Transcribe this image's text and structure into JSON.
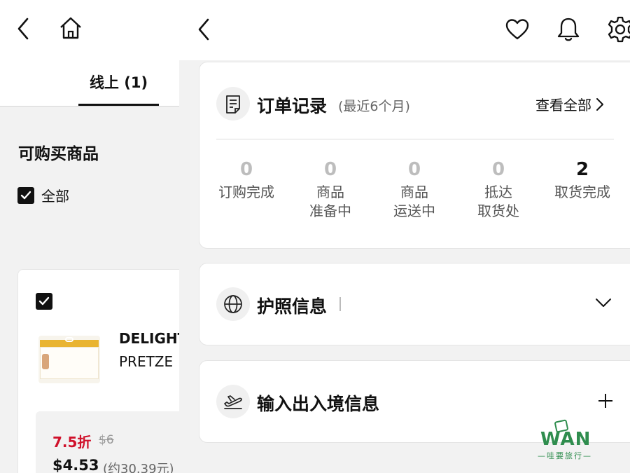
{
  "left_page": {
    "tabs": [
      {
        "label": "线上 (1)"
      }
    ],
    "section_title": "可购买商品",
    "select_all_label": "全部",
    "product": {
      "name_line1": "DELIGHT",
      "name_line2": "PRETZE",
      "discount": "7.5折",
      "original_price": "$6",
      "price": "$4.53",
      "approx_price": "(约30.39元)"
    }
  },
  "order_record": {
    "title": "订单记录",
    "subtitle": "(最近6个月)",
    "view_all_label": "查看全部",
    "stats": [
      {
        "count": "0",
        "label_line1": "订购完成",
        "label_line2": ""
      },
      {
        "count": "0",
        "label_line1": "商品",
        "label_line2": "准备中"
      },
      {
        "count": "0",
        "label_line1": "商品",
        "label_line2": "运送中"
      },
      {
        "count": "0",
        "label_line1": "抵达",
        "label_line2": "取货处"
      },
      {
        "count": "2",
        "label_line1": "取货完成",
        "label_line2": ""
      }
    ]
  },
  "passport": {
    "title": "护照信息"
  },
  "entry_exit": {
    "title": "输入出入境信息"
  },
  "watermark": {
    "text": "WAN",
    "subtext": "—哇要旅行—"
  },
  "icons": {
    "left_topbar": [
      "back-icon",
      "home-icon"
    ],
    "right_topbar": [
      "back-icon",
      "heart-icon",
      "bell-icon",
      "gear-icon"
    ],
    "cards": [
      "document-icon",
      "globe-icon",
      "airplane-icon"
    ]
  },
  "colors": {
    "accent_red": "#d0112b",
    "muted_count": "#bdbdbd",
    "background": "#f2f2f2",
    "watermark_green": "#2f8d4e"
  }
}
